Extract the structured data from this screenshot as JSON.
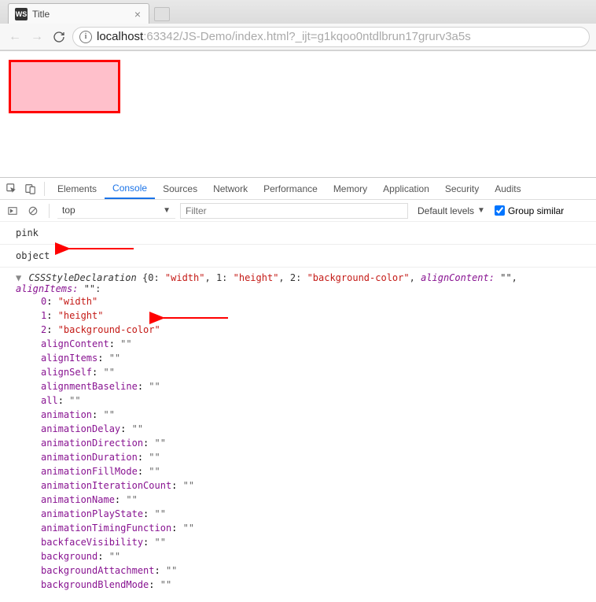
{
  "tab": {
    "favicon": "WS",
    "title": "Title",
    "close": "×"
  },
  "url": {
    "host": "localhost",
    "rest": ":63342/JS-Demo/index.html?_ijt=g1kqoo0ntdlbrun17grurv3a5s"
  },
  "devtools": {
    "tabs": [
      "Elements",
      "Console",
      "Sources",
      "Network",
      "Performance",
      "Memory",
      "Application",
      "Security",
      "Audits"
    ],
    "activeTab": "Console",
    "context": "top",
    "filterPlaceholder": "Filter",
    "levels": "Default levels",
    "groupSimilar": "Group similar"
  },
  "console": {
    "log1": "pink",
    "log2": "object",
    "objName": "CSSStyleDeclaration",
    "summaryKeys": [
      {
        "k": "0",
        "v": "\"width\""
      },
      {
        "k": "1",
        "v": "\"height\""
      },
      {
        "k": "2",
        "v": "\"background-color\""
      }
    ],
    "summaryTrailProps": [
      "alignContent",
      "alignItems"
    ],
    "indexedProps": [
      {
        "k": "0",
        "v": "\"width\""
      },
      {
        "k": "1",
        "v": "\"height\""
      },
      {
        "k": "2",
        "v": "\"background-color\""
      }
    ],
    "namedProps": [
      "alignContent",
      "alignItems",
      "alignSelf",
      "alignmentBaseline",
      "all",
      "animation",
      "animationDelay",
      "animationDirection",
      "animationDuration",
      "animationFillMode",
      "animationIterationCount",
      "animationName",
      "animationPlayState",
      "animationTimingFunction",
      "backfaceVisibility",
      "background",
      "backgroundAttachment",
      "backgroundBlendMode"
    ],
    "emptyVal": "\"\""
  }
}
